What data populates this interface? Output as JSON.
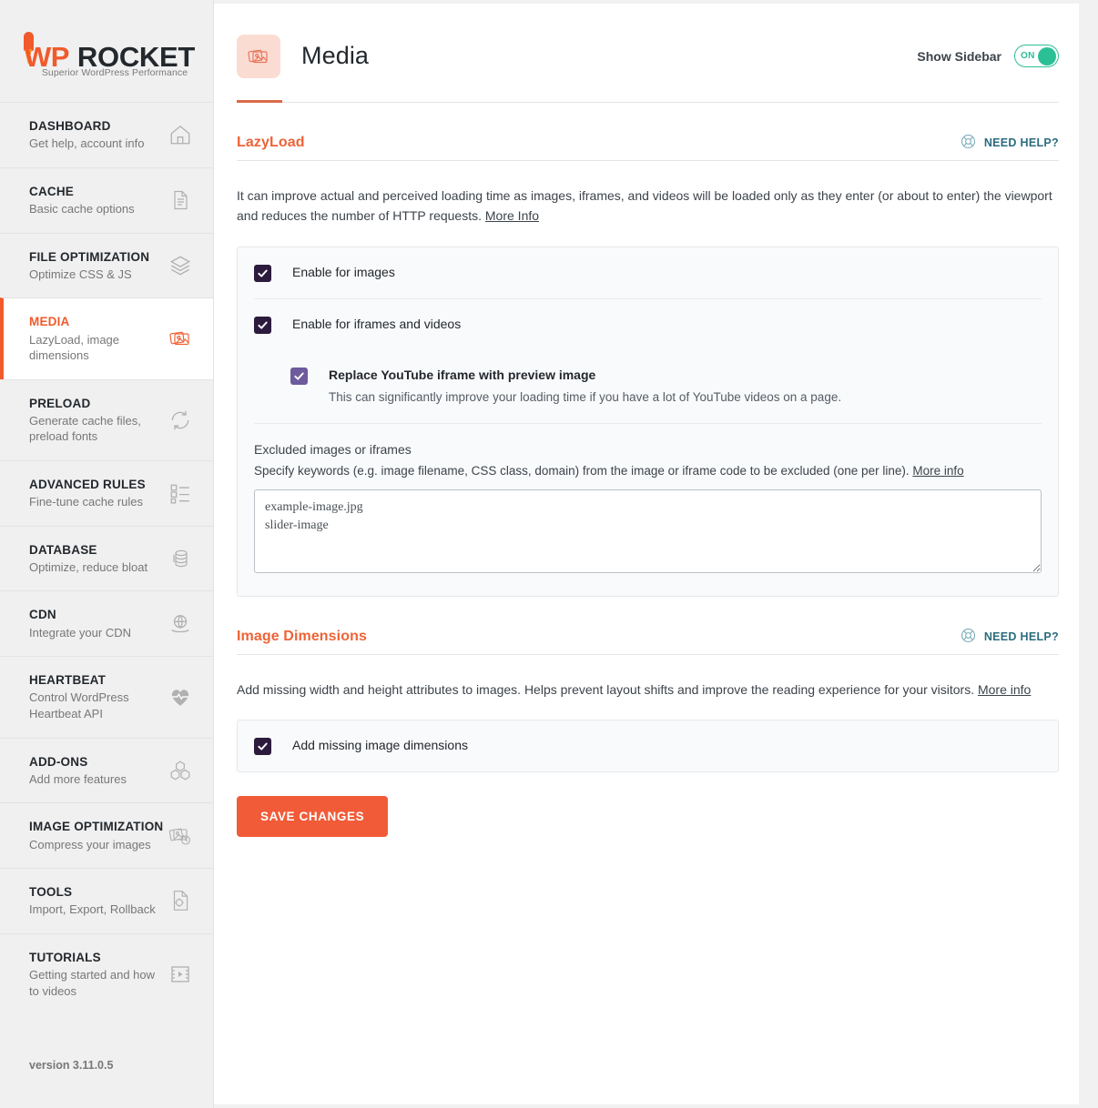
{
  "brand": {
    "name_highlight": "WP",
    "name_rest": "ROCKET",
    "tagline": "Superior WordPress Performance",
    "version": "version 3.11.0.5",
    "accent": "#f15a2b"
  },
  "sidebar": {
    "items": [
      {
        "title": "DASHBOARD",
        "sub": "Get help, account info",
        "icon": "home-icon"
      },
      {
        "title": "CACHE",
        "sub": "Basic cache options",
        "icon": "document-icon"
      },
      {
        "title": "FILE OPTIMIZATION",
        "sub": "Optimize CSS & JS",
        "icon": "layers-icon"
      },
      {
        "title": "MEDIA",
        "sub": "LazyLoad, image dimensions",
        "icon": "media-photos-icon"
      },
      {
        "title": "PRELOAD",
        "sub": "Generate cache files, preload fonts",
        "icon": "refresh-icon"
      },
      {
        "title": "ADVANCED RULES",
        "sub": "Fine-tune cache rules",
        "icon": "checklist-icon"
      },
      {
        "title": "DATABASE",
        "sub": "Optimize, reduce bloat",
        "icon": "database-icon"
      },
      {
        "title": "CDN",
        "sub": "Integrate your CDN",
        "icon": "cdn-globe-hand-icon"
      },
      {
        "title": "HEARTBEAT",
        "sub": "Control WordPress Heartbeat API",
        "icon": "heart-pulse-icon"
      },
      {
        "title": "ADD-ONS",
        "sub": "Add more features",
        "icon": "blocks-icon"
      },
      {
        "title": "IMAGE OPTIMIZATION",
        "sub": "Compress your images",
        "icon": "image-compress-icon"
      },
      {
        "title": "TOOLS",
        "sub": "Import, Export, Rollback",
        "icon": "file-gear-icon"
      },
      {
        "title": "TUTORIALS",
        "sub": "Getting started and how to videos",
        "icon": "video-play-icon"
      }
    ],
    "active_index": 3
  },
  "header": {
    "icon": "media-photos-icon",
    "title": "Media",
    "show_sidebar_label": "Show Sidebar",
    "toggle_state": "ON",
    "toggle_color": "#2bbf96"
  },
  "lazyload": {
    "title": "LazyLoad",
    "need_help": "NEED HELP?",
    "need_help_icon": "lifebuoy-icon",
    "description": "It can improve actual and perceived loading time as images, iframes, and videos will be loaded only as they enter (or about to enter) the viewport and reduces the number of HTTP requests.",
    "description_link": "More Info",
    "options": [
      {
        "label": "Enable for images",
        "checked": true
      },
      {
        "label": "Enable for iframes and videos",
        "checked": true
      }
    ],
    "nested_option": {
      "label": "Replace YouTube iframe with preview image",
      "desc": "This can significantly improve your loading time if you have a lot of YouTube videos on a page.",
      "checked": true
    },
    "excluded": {
      "title": "Excluded images or iframes",
      "help": "Specify keywords (e.g. image filename, CSS class, domain) from the image or iframe code to be excluded (one per line).",
      "help_link": "More info",
      "value": "example-image.jpg\nslider-image",
      "placeholder": ""
    }
  },
  "image_dimensions": {
    "title": "Image Dimensions",
    "need_help": "NEED HELP?",
    "description": "Add missing width and height attributes to images. Helps prevent layout shifts and improve the reading experience for your visitors.",
    "description_link": "More info",
    "option": {
      "label": "Add missing image dimensions",
      "checked": true
    }
  },
  "save_button": {
    "label": "SAVE CHANGES",
    "color": "#f15b38"
  }
}
